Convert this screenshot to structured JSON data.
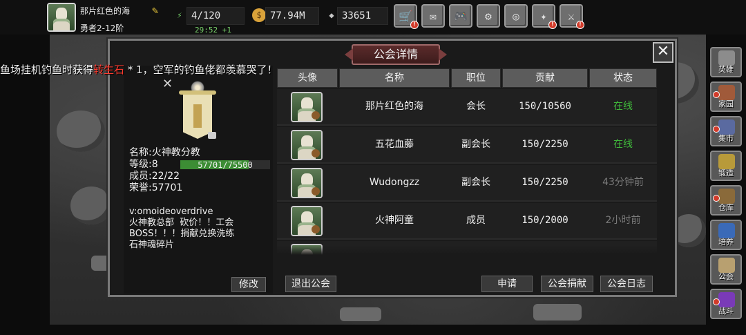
{
  "player": {
    "name": "那片红色的海",
    "rank": "勇者2-12阶"
  },
  "stats": {
    "energy": "4/120",
    "energy_timer": "29:52 +1",
    "gold": "77.94M",
    "gems": "33651"
  },
  "top_menu": [
    {
      "icon": "shop-cart-icon",
      "glyph": "🛒",
      "alert": true
    },
    {
      "icon": "mail-icon",
      "glyph": "✉",
      "alert": false
    },
    {
      "icon": "gamepad-icon",
      "glyph": "🎮",
      "alert": false
    },
    {
      "icon": "gear-icon",
      "glyph": "⚙",
      "alert": false
    },
    {
      "icon": "wheel-icon",
      "glyph": "◎",
      "alert": false
    },
    {
      "icon": "meteor-icon",
      "glyph": "✦",
      "alert": true
    },
    {
      "icon": "crossed-swords-icon",
      "glyph": "⚔",
      "alert": true
    }
  ],
  "ticker": {
    "before": "鱼场挂机钓鱼时获得",
    "highlight": "转生石",
    "after": " * 1，空军的钓鱼佬都羡慕哭了！"
  },
  "sidenav": [
    {
      "label": "英雄",
      "icon": "helmet-icon",
      "color": "#8c8c8c",
      "alert": false
    },
    {
      "label": "家园",
      "icon": "house-icon",
      "color": "#a05a3a",
      "alert": true
    },
    {
      "label": "集市",
      "icon": "market-stall-icon",
      "color": "#5a6aa0",
      "alert": true
    },
    {
      "label": "锻造",
      "icon": "anvil-icon",
      "color": "#b89a3a",
      "alert": false
    },
    {
      "label": "仓库",
      "icon": "warehouse-icon",
      "color": "#8a6a3a",
      "alert": true
    },
    {
      "label": "培养",
      "icon": "trophy-icon",
      "color": "#3a6ab8",
      "alert": false
    },
    {
      "label": "公会",
      "icon": "guild-icon",
      "color": "#b8a070",
      "alert": false
    },
    {
      "label": "战斗",
      "icon": "portal-icon",
      "color": "#7a3ab8",
      "alert": true
    }
  ],
  "dialog": {
    "title": "公会详情",
    "close_glyph": "✕"
  },
  "guild": {
    "name_label": "名称:",
    "name": "火神教分教",
    "level_label": "等级:",
    "level": "8",
    "level_exp_text": "57701/75500",
    "level_exp_fraction": 0.764,
    "members_label": "成员:",
    "members": "22/22",
    "honor_label": "荣誉:",
    "honor": "57701",
    "notice": "v:omoideoverdrive\n火神教总部  砍价！！工会\nBOSS！！！捐献兑换洗练\n石神魂碎片",
    "edit_label": "修改",
    "close_glyph": "✕"
  },
  "table": {
    "headers": [
      "头像",
      "名称",
      "职位",
      "贡献",
      "状态"
    ],
    "rows": [
      {
        "name": "那片红色的海",
        "role": "会长",
        "contribution": "150/10560",
        "status": "在线",
        "online": true
      },
      {
        "name": "五花血藤",
        "role": "副会长",
        "contribution": "150/2250",
        "status": "在线",
        "online": true
      },
      {
        "name": "Wudongzz",
        "role": "副会长",
        "contribution": "150/2250",
        "status": "43分钟前",
        "online": false
      },
      {
        "name": "火神阿童",
        "role": "成员",
        "contribution": "150/2000",
        "status": "2小时前",
        "online": false
      }
    ]
  },
  "buttons": {
    "leave": "退出公会",
    "apply": "申请",
    "donate": "公会捐献",
    "log": "公会日志"
  }
}
